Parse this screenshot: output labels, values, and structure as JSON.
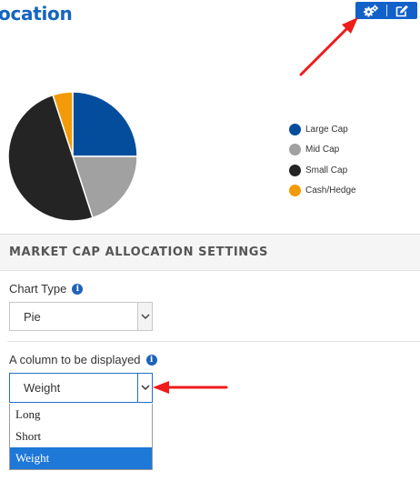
{
  "header": {
    "title": "ocation"
  },
  "toolbar": {
    "settings_icon": "gears-icon",
    "edit_icon": "edit-icon"
  },
  "chart_data": {
    "type": "pie",
    "labels": [
      "Large Cap",
      "Mid Cap",
      "Small Cap",
      "Cash/Hedge"
    ],
    "values": [
      25,
      20,
      50,
      5
    ],
    "colors": [
      "#034d9c",
      "#a1a1a1",
      "#242424",
      "#f29a08"
    ],
    "legend_position": "right"
  },
  "settings": {
    "title": "MARKET CAP ALLOCATION SETTINGS",
    "chart_type_label": "Chart Type",
    "chart_type_value": "Pie",
    "column_label": "A column to be displayed",
    "column_value": "Weight",
    "column_options": [
      "Long",
      "Short",
      "Weight"
    ],
    "column_selected": "Weight"
  },
  "annotations": {
    "arrow_color": "#ee1c1c"
  }
}
